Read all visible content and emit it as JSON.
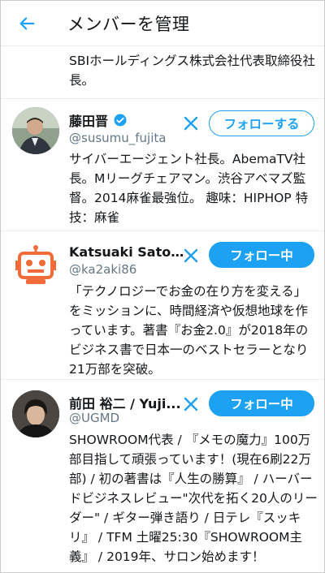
{
  "header": {
    "title": "メンバーを管理",
    "back_icon": "arrow-left-icon",
    "accent_color": "#1da1f2"
  },
  "previous_bio": "SBIホールディングス株式会社代表取締役社長。",
  "members": [
    {
      "name": "藤田晋",
      "verified": true,
      "handle": "@susumu_fujita",
      "follow_label": "フォローする",
      "follow_state": "not-following",
      "bio": "サイバーエージェント社長。AbemaTV社長。Mリーグチェアマン。渋谷アベマズ監督。2014麻雀最強位。 趣味：HIPHOP 特技：麻雀"
    },
    {
      "name": "Katsuaki Sato ...",
      "verified": false,
      "handle": "@ka2aki86",
      "follow_label": "フォロー中",
      "follow_state": "following",
      "bio": "「テクノロジーでお金の在り方を変える」をミッションに、時間経済や仮想地球を作っています。著書『お金2.0』が2018年のビジネス書で日本一のベストセラーとなり21万部を突破。"
    },
    {
      "name": "前田 裕二 / Yuji...",
      "verified": false,
      "handle": "@UGMD",
      "follow_label": "フォロー中",
      "follow_state": "following",
      "bio": "SHOWROOM代表 / 『メモの魔力』100万部目指して頑張っています！(現在6刷22万部) / 初の著書は『人生の勝算』 / ハーバードビジネスレビュー\"次代を拓く20人のリーダー\" / ギター弾き語り / 日テレ『スッキリ』 / TFM 土曜25:30『SHOWROOM主義』 / 2019年、サロン始めます！"
    }
  ]
}
